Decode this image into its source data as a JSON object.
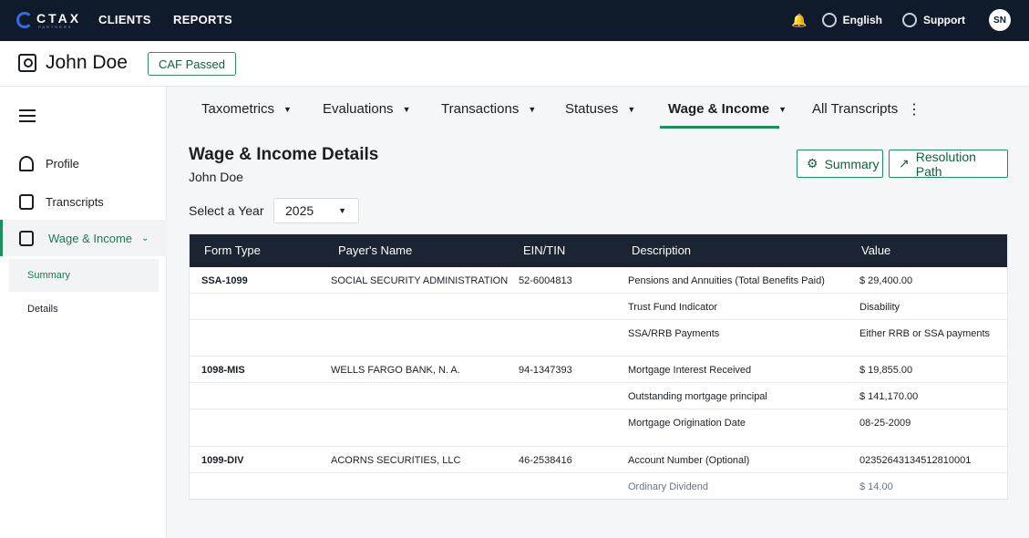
{
  "brand": {
    "name": "CTAX",
    "sub": "PARTNERS",
    "accent": "#1a8f5c",
    "topbar_bg": "#0f1a2b"
  },
  "topnav": {
    "clients": "CLIENTS",
    "reports": "REPORTS",
    "language": "English",
    "support": "Support",
    "avatar_initials": "SN"
  },
  "client": {
    "name": "John Doe",
    "caf_status": "CAF Passed"
  },
  "sidebar": {
    "items": [
      {
        "label": "Profile"
      },
      {
        "label": "Transcripts"
      },
      {
        "label": "Wage & Income"
      }
    ],
    "sub_items": [
      {
        "label": "Summary"
      },
      {
        "label": "Details"
      }
    ]
  },
  "tabs": [
    {
      "label": "Taxometrics"
    },
    {
      "label": "Evaluations"
    },
    {
      "label": "Transactions"
    },
    {
      "label": "Statuses"
    },
    {
      "label": "Wage & Income"
    },
    {
      "label": "All Transcripts"
    }
  ],
  "main": {
    "title": "Wage & Income Details",
    "subtitle": "John Doe",
    "year_label": "Select a Year",
    "year_value": "2025",
    "summary_button": "Summary",
    "resolution_button": "Resolution Path"
  },
  "table": {
    "headers": [
      "Form Type",
      "Payer's Name",
      "EIN/TIN",
      "Description",
      "Value"
    ],
    "rows": [
      {
        "form": "SSA-1099",
        "payer": "SOCIAL SECURITY ADMINISTRATION",
        "ein": "52-6004813",
        "desc": "Pensions and Annuities (Total Benefits Paid)",
        "value": "$ 29,400.00"
      },
      {
        "form": "",
        "payer": "",
        "ein": "",
        "desc": "Trust Fund Indicator",
        "value": "Disability"
      },
      {
        "form": "",
        "payer": "",
        "ein": "",
        "desc": "SSA/RRB Payments",
        "value": "Either RRB or SSA payments"
      },
      {
        "form": "1098-MIS",
        "payer": "WELLS FARGO BANK, N. A.",
        "ein": "94-1347393",
        "desc": "Mortgage Interest Received",
        "value": "$ 19,855.00"
      },
      {
        "form": "",
        "payer": "",
        "ein": "",
        "desc": "Outstanding mortgage principal",
        "value": "$ 141,170.00"
      },
      {
        "form": "",
        "payer": "",
        "ein": "",
        "desc": "Mortgage Origination Date",
        "value": "08-25-2009"
      },
      {
        "form": "1099-DIV",
        "payer": "ACORNS SECURITIES, LLC",
        "ein": "46-2538416",
        "desc": "Account Number (Optional)",
        "value": "02352643134512810001"
      },
      {
        "form": "",
        "payer": "",
        "ein": "",
        "desc": "Ordinary Dividend",
        "value": "$ 14.00"
      }
    ]
  }
}
